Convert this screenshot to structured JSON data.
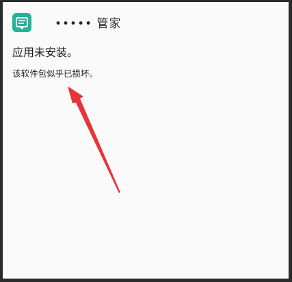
{
  "header": {
    "app_icon": "app-store-icon",
    "app_name": "••••• 管家"
  },
  "dialog": {
    "title": "应用未安装。",
    "message": "该软件包似乎已损坏。"
  },
  "annotation": {
    "arrow_color": "#e8333a",
    "arrow_icon": "red-arrow-icon"
  }
}
